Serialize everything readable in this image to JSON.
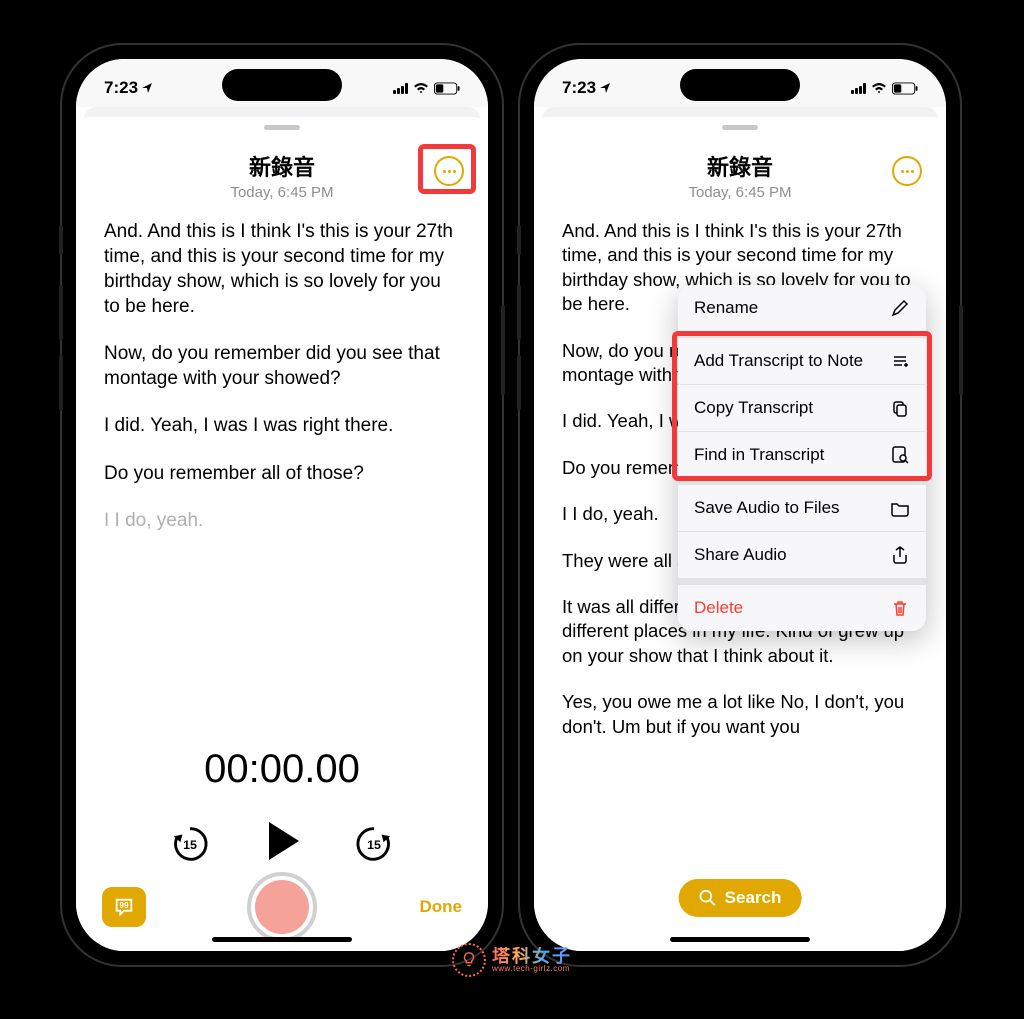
{
  "status": {
    "time": "7:23"
  },
  "header": {
    "title": "新錄音",
    "subtitle": "Today, 6:45 PM"
  },
  "transcript_left": {
    "p1": "And. And this is I think I's this is your 27th time, and this is your second time for my birthday show, which is so lovely for you to be here.",
    "p2": "Now, do you remember did you see that montage with your showed?",
    "p3": "I did. Yeah, I was I was right there.",
    "p4": "Do you remember all of those?",
    "p5": "I I do, yeah."
  },
  "transcript_right": {
    "p1": "And. And this is I think I's this is your 27th time, and this is your second time for my birthday show, which is so lovely for you to be here.",
    "p2": "Now, do you remember did you see that montage with your showed?",
    "p3": "I did. Yeah, I was I was right there.",
    "p4": "Do you remember all of those?",
    "p5": "I I do, yeah.",
    "p6": "They were all so different.",
    "p7": "It was all different places times in my life, different places in my life. Kind of grew up on your show that I think about it.",
    "p8": "Yes, you owe me a lot like No, I don't, you don't. Um but if you want you"
  },
  "timer": "00:00.00",
  "skip_back": "15",
  "skip_fwd": "15",
  "done": "Done",
  "search": "Search",
  "menu": {
    "rename": "Rename",
    "add_note": "Add Transcript to Note",
    "copy": "Copy Transcript",
    "find": "Find in Transcript",
    "save_audio": "Save Audio to Files",
    "share_audio": "Share Audio",
    "delete": "Delete"
  },
  "logo": {
    "cn": "塔科女子",
    "en": "www.tech-girlz.com"
  }
}
